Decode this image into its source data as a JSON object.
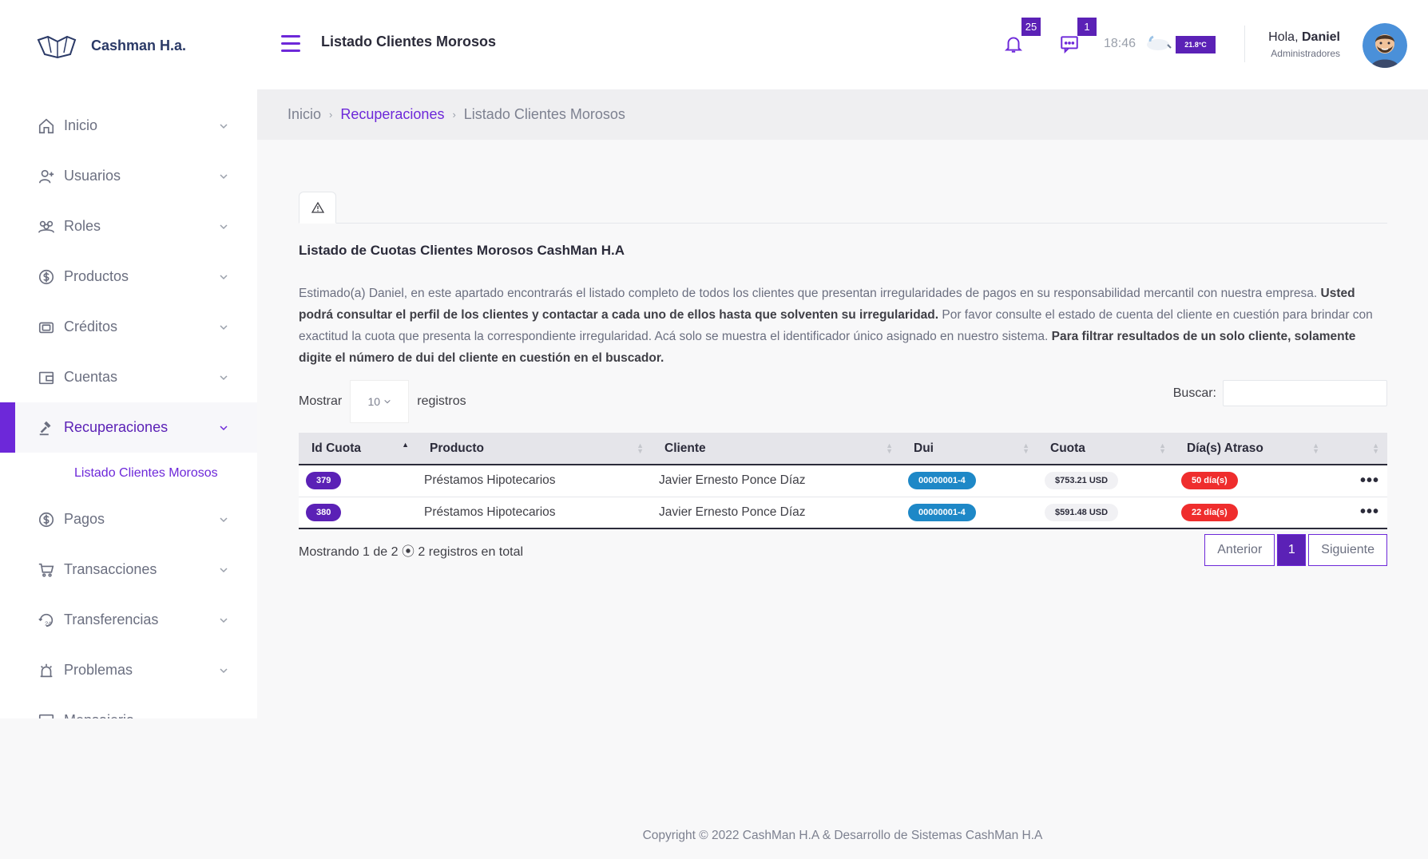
{
  "brand": {
    "name": "Cashman H.a."
  },
  "header": {
    "title": "Listado Clientes Morosos",
    "notif_count": "25",
    "msg_count": "1",
    "time": "18:46",
    "temp": "21.8°C",
    "greeting": "Hola,",
    "user": "Daniel",
    "role": "Administradores"
  },
  "sidebar": {
    "items": [
      {
        "label": "Inicio",
        "icon": "home-icon"
      },
      {
        "label": "Usuarios",
        "icon": "user-add-icon"
      },
      {
        "label": "Roles",
        "icon": "group-icon"
      },
      {
        "label": "Productos",
        "icon": "dollar-circle-icon"
      },
      {
        "label": "Créditos",
        "icon": "card-icon"
      },
      {
        "label": "Cuentas",
        "icon": "wallet-icon"
      },
      {
        "label": "Recuperaciones",
        "icon": "gavel-icon"
      },
      {
        "label": "Pagos",
        "icon": "dollar-circle-icon"
      },
      {
        "label": "Transacciones",
        "icon": "cart-icon"
      },
      {
        "label": "Transferencias",
        "icon": "24h-icon"
      },
      {
        "label": "Problemas",
        "icon": "alarm-icon"
      },
      {
        "label": "Mensajeria",
        "icon": "chat-icon"
      }
    ],
    "active_sub": "Listado Clientes Morosos"
  },
  "breadcrumb": {
    "home": "Inicio",
    "section": "Recuperaciones",
    "current": "Listado Clientes Morosos"
  },
  "card": {
    "tab_icon": "warning-icon",
    "title": "Listado de Cuotas Clientes Morosos CashMan H.A",
    "desc_1": "Estimado(a) Daniel, en este apartado encontrarás el listado completo de todos los clientes que presentan irregularidades de pagos en su responsabilidad mercantil con nuestra empresa. ",
    "desc_2": "Usted podrá consultar el perfil de los clientes y contactar a cada uno de ellos hasta que solventen su irregularidad.",
    "desc_3": " Por favor consulte el estado de cuenta del cliente en cuestión para brindar con exactitud la cuota que presenta la correspondiente irregularidad. Acá solo se muestra el identificador único asignado en nuestro sistema. ",
    "desc_4": "Para filtrar resultados de un solo cliente, solamente digite el número de dui del cliente en cuestión en el buscador."
  },
  "table": {
    "show_label": "Mostrar",
    "page_size": "10",
    "records_label": "registros",
    "search_label": "Buscar:",
    "headers": [
      "Id Cuota",
      "Producto",
      "Cliente",
      "Dui",
      "Cuota",
      "Día(s) Atraso"
    ],
    "rows": [
      {
        "id": "379",
        "producto": "Préstamos Hipotecarios",
        "cliente": "Javier Ernesto Ponce Díaz",
        "dui": "00000001-4",
        "cuota": "$753.21 USD",
        "atraso": "50 día(s)"
      },
      {
        "id": "380",
        "producto": "Préstamos Hipotecarios",
        "cliente": "Javier Ernesto Ponce Díaz",
        "dui": "00000001-4",
        "cuota": "$591.48 USD",
        "atraso": "22 día(s)"
      }
    ],
    "info": "Mostrando 1 de 2 ⦿ 2 registros en total",
    "prev": "Anterior",
    "page": "1",
    "next": "Siguiente"
  },
  "footer": {
    "copyright": "Copyright © 2022 CashMan H.A & Desarrollo de Sistemas CashMan H.A"
  }
}
